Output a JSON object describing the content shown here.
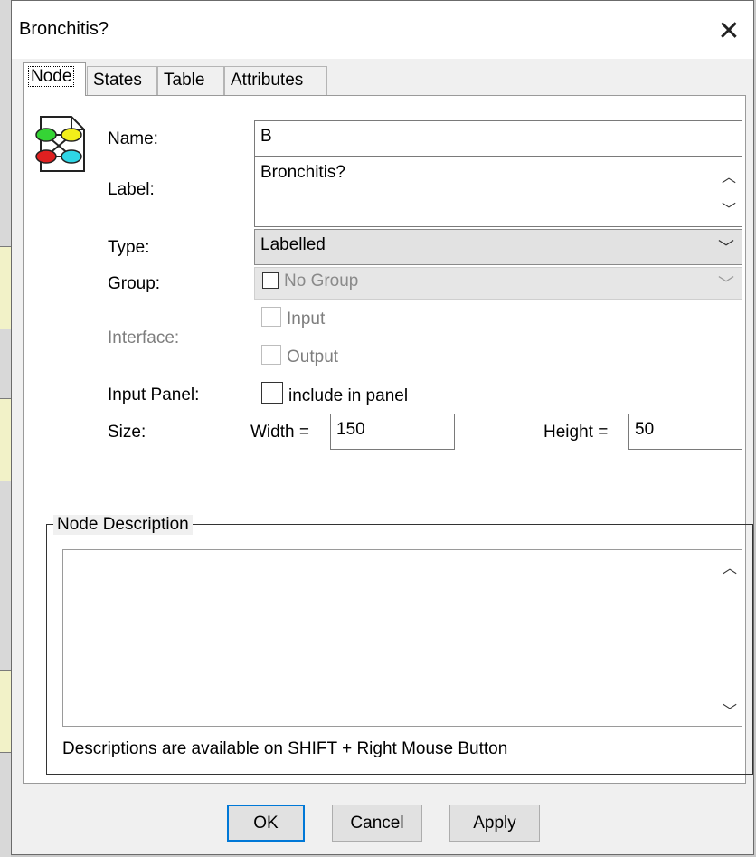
{
  "window": {
    "title": "Bronchitis?",
    "close_glyph": "✕"
  },
  "tabs": [
    "Node",
    "States",
    "Table",
    "Attributes"
  ],
  "active_tab": "Node",
  "node_icon": "network-node-icon",
  "form": {
    "name_label": "Name:",
    "name_value": "B",
    "label_label": "Label:",
    "label_value": "Bronchitis?",
    "type_label": "Type:",
    "type_value": "Labelled",
    "group_label": "Group:",
    "group_value": "No Group",
    "interface_label": "Interface:",
    "interface_input": "Input",
    "interface_output": "Output",
    "input_panel_label": "Input Panel:",
    "input_panel_option": "include in panel",
    "size_label": "Size:",
    "width_label": "Width =",
    "width_value": "150",
    "height_label": "Height =",
    "height_value": "50"
  },
  "description": {
    "legend": "Node Description",
    "value": "",
    "hint": "Descriptions are available on SHIFT + Right Mouse Button"
  },
  "buttons": {
    "ok": "OK",
    "cancel": "Cancel",
    "apply": "Apply"
  },
  "colors": {
    "accent": "#0078d7",
    "panel": "#ffffff",
    "dialog": "#f0f0f0"
  }
}
